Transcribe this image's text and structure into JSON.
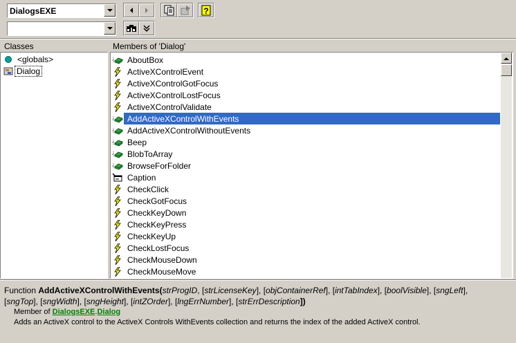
{
  "toolbar": {
    "library_combo_value": "DialogsEXE",
    "search_combo_value": ""
  },
  "classes": {
    "header": "Classes",
    "items": [
      {
        "label": "<globals>",
        "icon": "globe-icon"
      },
      {
        "label": "Dialog",
        "icon": "class-icon"
      }
    ]
  },
  "members": {
    "header": "Members of 'Dialog'",
    "selected": "AddActiveXControlWithEvents",
    "items": [
      {
        "label": "AboutBox",
        "icon": "method-icon"
      },
      {
        "label": "ActiveXControlEvent",
        "icon": "event-icon"
      },
      {
        "label": "ActiveXControlGotFocus",
        "icon": "event-icon"
      },
      {
        "label": "ActiveXControlLostFocus",
        "icon": "event-icon"
      },
      {
        "label": "ActiveXControlValidate",
        "icon": "event-icon"
      },
      {
        "label": "AddActiveXControlWithEvents",
        "icon": "method-icon"
      },
      {
        "label": "AddActiveXControlWithoutEvents",
        "icon": "method-icon"
      },
      {
        "label": "Beep",
        "icon": "method-icon"
      },
      {
        "label": "BlobToArray",
        "icon": "method-icon"
      },
      {
        "label": "BrowseForFolder",
        "icon": "method-icon"
      },
      {
        "label": "Caption",
        "icon": "property-icon"
      },
      {
        "label": "CheckClick",
        "icon": "event-icon"
      },
      {
        "label": "CheckGotFocus",
        "icon": "event-icon"
      },
      {
        "label": "CheckKeyDown",
        "icon": "event-icon"
      },
      {
        "label": "CheckKeyPress",
        "icon": "event-icon"
      },
      {
        "label": "CheckKeyUp",
        "icon": "event-icon"
      },
      {
        "label": "CheckLostFocus",
        "icon": "event-icon"
      },
      {
        "label": "CheckMouseDown",
        "icon": "event-icon"
      },
      {
        "label": "CheckMouseMove",
        "icon": "event-icon"
      }
    ]
  },
  "details": {
    "kind": "Function ",
    "name": "AddActiveXControlWithEvents",
    "open_paren": "(",
    "p1": "strProgID",
    "sep1": ", [",
    "p2": "strLicenseKey",
    "sep2": "], [",
    "p3": "objContainerRef",
    "sep3": "], [",
    "p4": "intTabIndex",
    "sep4": "], [",
    "p5": "boolVisible",
    "sep5": "], [",
    "p6": "sngLeft",
    "sep6": "],",
    "sep7": "[",
    "p7": "sngTop",
    "sep8": "], [",
    "p8": "sngWidth",
    "sep9": "], [",
    "p9": "sngHeight",
    "sep10": "], [",
    "p10": "intZOrder",
    "sep11": "], [",
    "p11": "lngErrNumber",
    "sep12": "], [",
    "p12": "strErrDescription",
    "close": "])",
    "member_of_prefix": "Member of ",
    "member_of_lib": "DialogsEXE",
    "member_of_dot": ".",
    "member_of_class": "Dialog",
    "summary": "Adds an ActiveX control to the ActiveX Controls WithEvents collection and returns the index of the added ActiveX control."
  },
  "colors": {
    "selection": "#316ac5",
    "link": "#008000",
    "face": "#d4d0c8"
  }
}
